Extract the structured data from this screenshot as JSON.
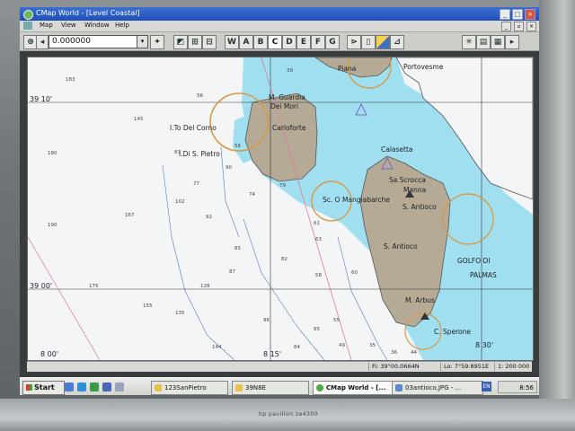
{
  "window": {
    "title": "CMap World - [Level Coastal]"
  },
  "menu": {
    "items": [
      "Map",
      "View",
      "Window",
      "Help"
    ]
  },
  "toolbar": {
    "zoom_value": "0.000000",
    "letter_buttons": [
      "W",
      "A",
      "B",
      "C",
      "D",
      "E",
      "F",
      "G"
    ],
    "selected_letter": "C"
  },
  "chart": {
    "place_labels": [
      {
        "id": "piana",
        "text": "Piana"
      },
      {
        "id": "portovesme",
        "text": "Portovesme"
      },
      {
        "id": "guardia",
        "text": "M. Guardia"
      },
      {
        "id": "dei-mori",
        "text": "Dei Mori"
      },
      {
        "id": "carloforte",
        "text": "Carloforte"
      },
      {
        "id": "isola-corno",
        "text": "I.To Del Corno"
      },
      {
        "id": "isola-pietro",
        "text": "I.Di S. Pietro"
      },
      {
        "id": "calasetta",
        "text": "Calasetta"
      },
      {
        "id": "sa-scrocca",
        "text": "Sa Scrocca"
      },
      {
        "id": "manna",
        "text": "Manna"
      },
      {
        "id": "mangiabarche",
        "text": "Sc. O Mangiabarche"
      },
      {
        "id": "s-antioco-1",
        "text": "S. Antioco"
      },
      {
        "id": "s-antioco-2",
        "text": "S. Antioco"
      },
      {
        "id": "golfo",
        "text": "GOLFO DI"
      },
      {
        "id": "palmas",
        "text": "PALMAS"
      },
      {
        "id": "m-arbus",
        "text": "M. Arbus"
      },
      {
        "id": "sperone",
        "text": "C. Sperone"
      }
    ],
    "lat_labels": [
      {
        "id": "lat-39-10",
        "text": "39 10'"
      },
      {
        "id": "lat-39-00",
        "text": "39 00'"
      },
      {
        "id": "lat-8-00",
        "text": "8 00'"
      },
      {
        "id": "lat-8-15",
        "text": "8 15'"
      },
      {
        "id": "lat-8-30",
        "text": "8 30'"
      }
    ],
    "depths": [
      "183",
      "39",
      "56",
      "145",
      "56",
      "180",
      "87",
      "90",
      "77",
      "102",
      "167",
      "92",
      "74",
      "190",
      "85",
      "175",
      "155",
      "128",
      "135",
      "96",
      "58",
      "61",
      "63",
      "60",
      "82",
      "55",
      "84",
      "49",
      "144",
      "65",
      "35",
      "36",
      "44",
      "87",
      "79"
    ]
  },
  "status": {
    "position": "Fi: 39°00.0664N",
    "longitude": "Lo: 7°59.8951E",
    "scale": "1: 200 000"
  },
  "taskbar": {
    "start_label": "Start",
    "tasks": [
      "123SanPietro",
      "39N8E",
      "CMap World - [...",
      "03antioco.JPG - ..."
    ],
    "clock": "8:56"
  },
  "device": {
    "brand": "hp pavilion ze4300"
  },
  "colors": {
    "water_shallow": "#9fdff0",
    "water_deep": "#f4f5f7",
    "land": "#b4aa96",
    "titlebar": "#1f4fb6"
  }
}
